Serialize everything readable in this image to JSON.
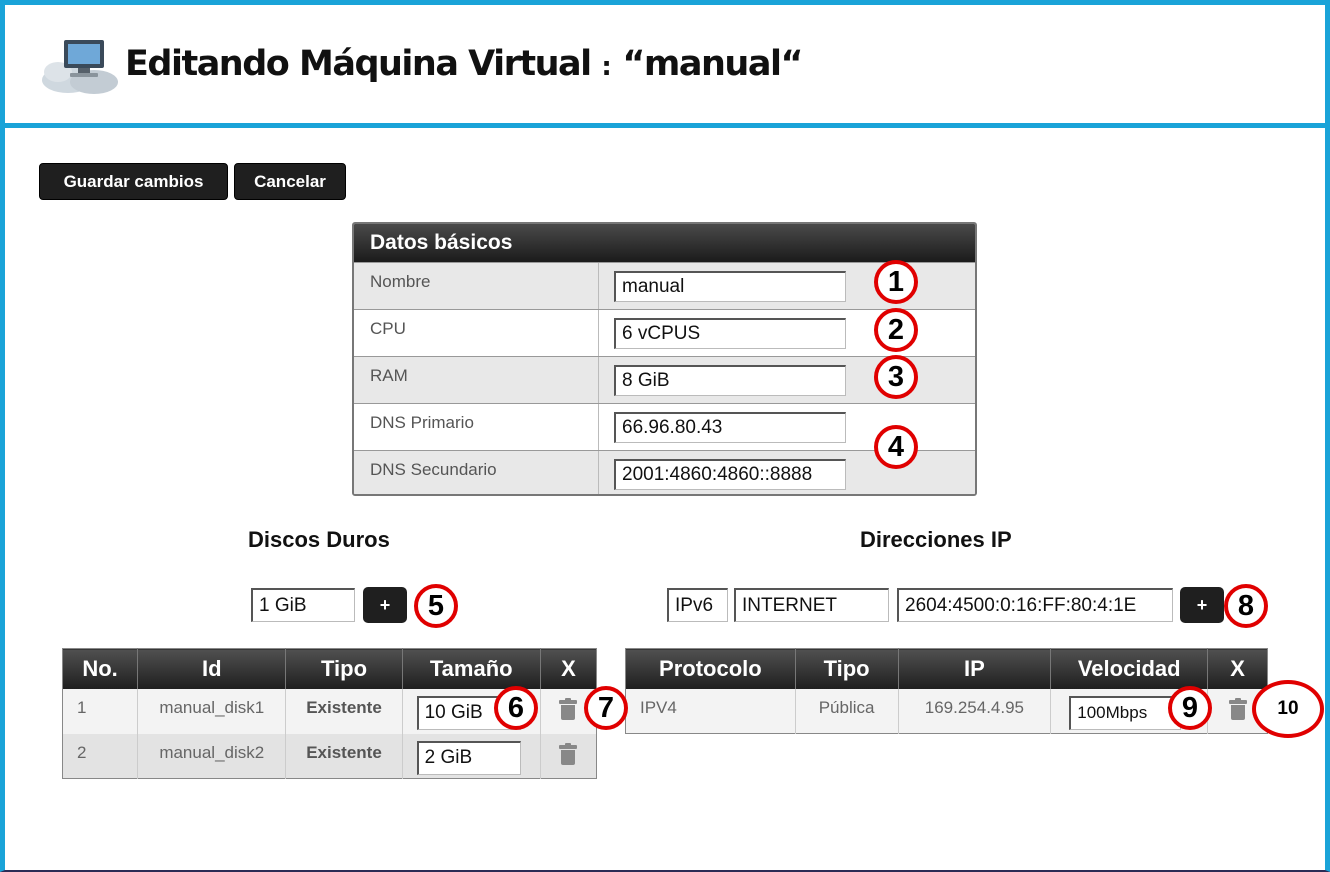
{
  "header": {
    "title": "Editando Máquina Virtual",
    "separator": ":",
    "vm_name_quoted": "“manual“"
  },
  "toolbar": {
    "save_label": "Guardar cambios",
    "cancel_label": "Cancelar"
  },
  "basic_data": {
    "title": "Datos básicos",
    "rows": [
      {
        "label": "Nombre",
        "value": "manual"
      },
      {
        "label": "CPU",
        "value": "6 vCPUS"
      },
      {
        "label": "RAM",
        "value": "8 GiB"
      },
      {
        "label": "DNS Primario",
        "value": "66.96.80.43"
      },
      {
        "label": "DNS Secundario",
        "value": "2001:4860:4860::8888"
      }
    ]
  },
  "disks": {
    "title": "Discos Duros",
    "new_size_value": "1 GiB",
    "add_label": "+",
    "columns": [
      "No.",
      "Id",
      "Tipo",
      "Tamaño",
      "X"
    ],
    "rows": [
      {
        "no": "1",
        "id": "manual_disk1",
        "type": "Existente",
        "size": "10 GiB"
      },
      {
        "no": "2",
        "id": "manual_disk2",
        "type": "Existente",
        "size": "2 GiB"
      }
    ]
  },
  "ips": {
    "title": "Direcciones IP",
    "new_protocol_value": "IPv6",
    "new_type_value": "INTERNET",
    "new_address_value": "2604:4500:0:16:FF:80:4:1E",
    "add_label": "+",
    "columns": [
      "Protocolo",
      "Tipo",
      "IP",
      "Velocidad",
      "X"
    ],
    "rows": [
      {
        "protocol": "IPV4",
        "type": "Pública",
        "ip": "169.254.4.95",
        "speed": "100Mbps"
      }
    ]
  },
  "annotations": [
    "1",
    "2",
    "3",
    "4",
    "5",
    "6",
    "7",
    "8",
    "9",
    "10"
  ],
  "colors": {
    "frame_border": "#1aa3d8",
    "button_bg": "#1f1f1f",
    "annotation_ring": "#e00000"
  },
  "icons": {
    "logo": "cloud-computer-icon",
    "delete": "trash-icon"
  }
}
